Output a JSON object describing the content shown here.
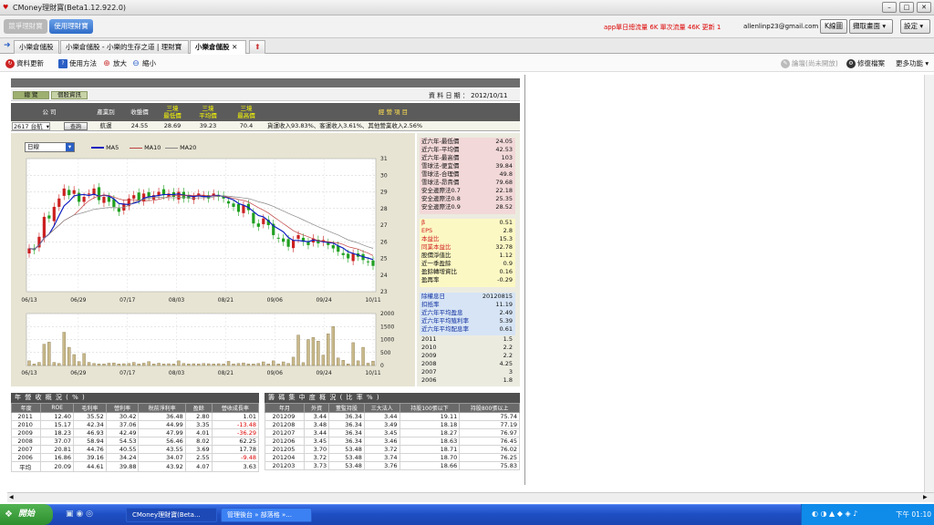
{
  "window": {
    "title": "CMoney理財寶(Beta1.12.922.0)"
  },
  "toolbar": {
    "btn1": "競爭理財寶",
    "btn2": "使用理財寶",
    "traffic": "app單日總流量 6K  單次流量 46K 更新 1",
    "email": "allenlinp23@gmail.com",
    "kline": "K線圖",
    "capture": "擷取畫面",
    "settings": "設定"
  },
  "tabs": [
    {
      "label": "小樂倉儲股"
    },
    {
      "label": "小樂倉儲股 - 小樂的生存之道 | 理財寶"
    },
    {
      "label": "小樂倉儲股"
    }
  ],
  "toolbar2": {
    "refresh": "資料更新",
    "howto": "使用方法",
    "zoom_in": "放大",
    "zoom_out": "縮小",
    "discuss": "論壇(尚未開放)",
    "fix": "修復檔案",
    "more": "更多功能"
  },
  "info": {
    "tab1": "總 覽",
    "tab2": "個股資訊",
    "date_label": "資 料 日 期 ：",
    "date": "2012/10/11"
  },
  "header": {
    "company": "公 司",
    "industry": "產業別",
    "close": "收盤價",
    "low3": "三境\n最低價",
    "avg3": "三境\n平均價",
    "high3": "三境\n最高價",
    "business": "經 營 項 目"
  },
  "stock": {
    "code": "2617",
    "name": "台航",
    "query": "查詢",
    "industry": "航運",
    "close": "24.55",
    "low3": "28.69",
    "avg3": "39.23",
    "high3": "70.4",
    "business": "貨運收入93.83%、客運收入3.61%、其他營業收入2.56%"
  },
  "chart_controls": {
    "period": "日線",
    "ma5": "MA5",
    "ma10": "MA10",
    "ma20": "MA20"
  },
  "chart_data": {
    "type": "candlestick",
    "dates": [
      "06/13",
      "06/29",
      "07/17",
      "08/03",
      "08/21",
      "09/06",
      "09/24",
      "10/11"
    ],
    "price_axis": [
      "31",
      "30",
      "29",
      "28",
      "27",
      "26",
      "25",
      "24",
      "23"
    ],
    "price_ylim": [
      23,
      31
    ],
    "volume_axis": [
      "2000",
      "1500",
      "1000",
      "500",
      "0"
    ],
    "volume_ylim": [
      0,
      2000
    ],
    "close": [
      25.6,
      25.5,
      26.3,
      27.5,
      27.4,
      28.1,
      28.6,
      29.2,
      28.8,
      29.1,
      28.4,
      28.7,
      28.9,
      29.2,
      28.5,
      28.7,
      28.4,
      28.1,
      27.8,
      28.3,
      28.6,
      28.8,
      28.5,
      28.9,
      28.7,
      28.8,
      29.0,
      28.8,
      28.9,
      28.7,
      29.0,
      28.6,
      28.6,
      28.7,
      28.9,
      28.8,
      28.6,
      28.9,
      28.7,
      28.6,
      28.3,
      28.1,
      27.8,
      28.2,
      27.9,
      27.1,
      26.9,
      27.4,
      27.0,
      26.4,
      26.2,
      26.0,
      25.7,
      26.1,
      26.4,
      26.0,
      25.8,
      26.2,
      25.9,
      26.1,
      25.8,
      25.6,
      25.4,
      25.2,
      25.0,
      25.3,
      25.1,
      24.9,
      24.8,
      24.55
    ],
    "volume": [
      180,
      60,
      120,
      820,
      900,
      120,
      80,
      1280,
      700,
      420,
      150,
      460,
      120,
      80,
      60,
      60,
      90,
      100,
      60,
      70,
      80,
      120,
      60,
      90,
      150,
      60,
      90,
      60,
      70,
      60,
      180,
      80,
      60,
      70,
      60,
      80,
      70,
      60,
      70,
      60,
      160,
      60,
      80,
      100,
      60,
      60,
      80,
      140,
      60,
      180,
      60,
      140,
      80,
      320,
      1170,
      110,
      1000,
      1080,
      940,
      400,
      1220,
      1500,
      290,
      200,
      60,
      880,
      180,
      700,
      90,
      170
    ]
  },
  "valuation": [
    {
      "k": "近六年-最低價",
      "v": "24.05"
    },
    {
      "k": "近六年-平均價",
      "v": "42.53"
    },
    {
      "k": "近六年-最高價",
      "v": "103"
    },
    {
      "k": "雪球法-便宜價",
      "v": "39.84"
    },
    {
      "k": "雪球法-合理價",
      "v": "49.8"
    },
    {
      "k": "雪球法-昂貴價",
      "v": "79.68"
    },
    {
      "k": "安全邊際法0.7",
      "v": "22.18"
    },
    {
      "k": "安全邊際法0.8",
      "v": "25.35"
    },
    {
      "k": "安全邊際法0.9",
      "v": "28.52"
    }
  ],
  "ratios": [
    {
      "k": "β",
      "v": "0.51"
    },
    {
      "k": "EPS",
      "v": "2.8"
    },
    {
      "k": "本益比",
      "v": "15.3"
    },
    {
      "k": "同業本益比",
      "v": "32.78"
    },
    {
      "k": "股價淨值比",
      "v": "1.12"
    },
    {
      "k": "近一季盈餘",
      "v": "0.9"
    },
    {
      "k": "盈餘轉增資比",
      "v": "0.16"
    },
    {
      "k": "盈再率",
      "v": "-0.29"
    }
  ],
  "dividends": {
    "head": [
      {
        "k": "除權息日",
        "v": "20120815"
      },
      {
        "k": "扣抵率",
        "v": "11.19"
      },
      {
        "k": "近六年平均盈息",
        "v": "2.49"
      },
      {
        "k": "近六年平均殖利率",
        "v": "5.39"
      },
      {
        "k": "近六年平均配息率",
        "v": "0.61"
      }
    ],
    "years": [
      {
        "k": "2011",
        "v": "1.5"
      },
      {
        "k": "2010",
        "v": "2.2"
      },
      {
        "k": "2009",
        "v": "2.2"
      },
      {
        "k": "2008",
        "v": "4.25"
      },
      {
        "k": "2007",
        "v": "3"
      },
      {
        "k": "2006",
        "v": "1.8"
      }
    ]
  },
  "annual": {
    "title": "年 營 收 概 況 ( % )",
    "cols": [
      "年度",
      "ROE",
      "毛利率",
      "營利率",
      "稅前淨利率",
      "盈餘",
      "營收成長率"
    ],
    "rows": [
      [
        "2011",
        "12.40",
        "35.52",
        "30.42",
        "36.48",
        "2.80",
        "1.01"
      ],
      [
        "2010",
        "15.17",
        "42.34",
        "37.06",
        "44.99",
        "3.35",
        "-13.48"
      ],
      [
        "2009",
        "18.23",
        "46.93",
        "42.49",
        "47.99",
        "4.01",
        "-36.29"
      ],
      [
        "2008",
        "37.07",
        "58.94",
        "54.53",
        "56.46",
        "8.02",
        "62.25"
      ],
      [
        "2007",
        "20.81",
        "44.76",
        "40.55",
        "43.55",
        "3.69",
        "17.78"
      ],
      [
        "2006",
        "16.86",
        "39.16",
        "34.24",
        "34.07",
        "2.55",
        "-9.48"
      ],
      [
        "平均",
        "20.09",
        "44.61",
        "39.88",
        "43.92",
        "4.07",
        "3.63"
      ]
    ]
  },
  "holding": {
    "title": "籌 碼 集 中 度 概 況 ( 比 率 % )",
    "cols": [
      "年月",
      "外資",
      "董監持股",
      "三大法人",
      "持股100張以下",
      "持股800張以上"
    ],
    "rows": [
      [
        "201209",
        "3.44",
        "36.34",
        "3.44",
        "19.11",
        "75.74"
      ],
      [
        "201208",
        "3.48",
        "36.34",
        "3.49",
        "18.18",
        "77.19"
      ],
      [
        "201207",
        "3.44",
        "36.34",
        "3.45",
        "18.27",
        "76.97"
      ],
      [
        "201206",
        "3.45",
        "36.34",
        "3.46",
        "18.63",
        "76.45"
      ],
      [
        "201205",
        "3.70",
        "53.48",
        "3.72",
        "18.71",
        "76.02"
      ],
      [
        "201204",
        "3.72",
        "53.48",
        "3.74",
        "18.70",
        "76.25"
      ],
      [
        "201203",
        "3.73",
        "53.48",
        "3.76",
        "18.66",
        "75.83"
      ]
    ]
  },
  "taskbar": {
    "start": "開始",
    "task1": "CMoney理財寶(Beta...",
    "task2": "管理後台 » 部落格 »...",
    "clock": "下午 01:10"
  },
  "colors": {
    "ma5": "#1020c0",
    "ma10": "#c04040",
    "ma20": "#888888",
    "up": "#cc2020",
    "down": "#20a020"
  }
}
